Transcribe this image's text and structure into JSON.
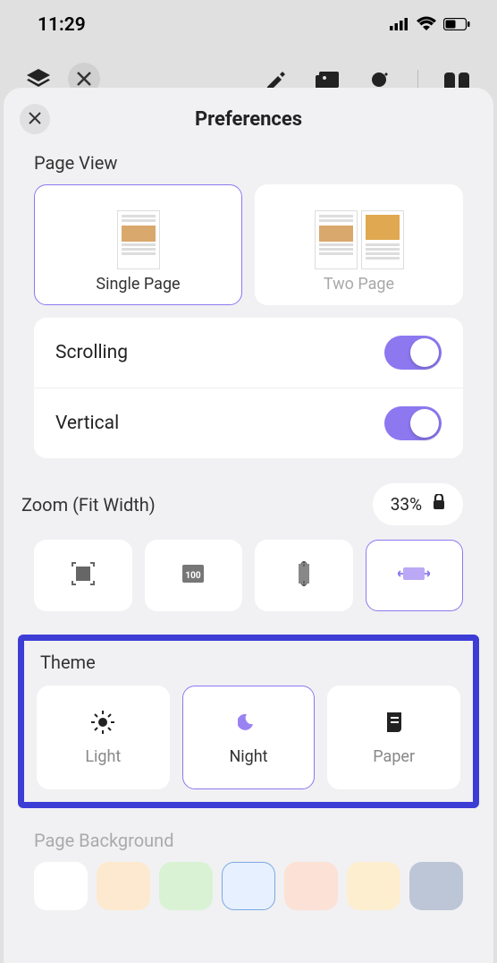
{
  "status": {
    "time": "11:29"
  },
  "sheet": {
    "title": "Preferences"
  },
  "page_view": {
    "label": "Page View",
    "single": "Single Page",
    "two": "Two Page"
  },
  "toggles": {
    "scrolling": "Scrolling",
    "vertical": "Vertical",
    "scrolling_on": true,
    "vertical_on": true
  },
  "zoom": {
    "label": "Zoom (Fit Width)",
    "value": "33%"
  },
  "theme": {
    "label": "Theme",
    "light": "Light",
    "night": "Night",
    "paper": "Paper",
    "selected": "night"
  },
  "background": {
    "label": "Page Background",
    "colors": [
      "#ffffff",
      "#fde9cf",
      "#d9f2d4",
      "#e7f0ff",
      "#fce1d6",
      "#fdeed0",
      "#bcc6d6"
    ],
    "selected_index": 3
  }
}
